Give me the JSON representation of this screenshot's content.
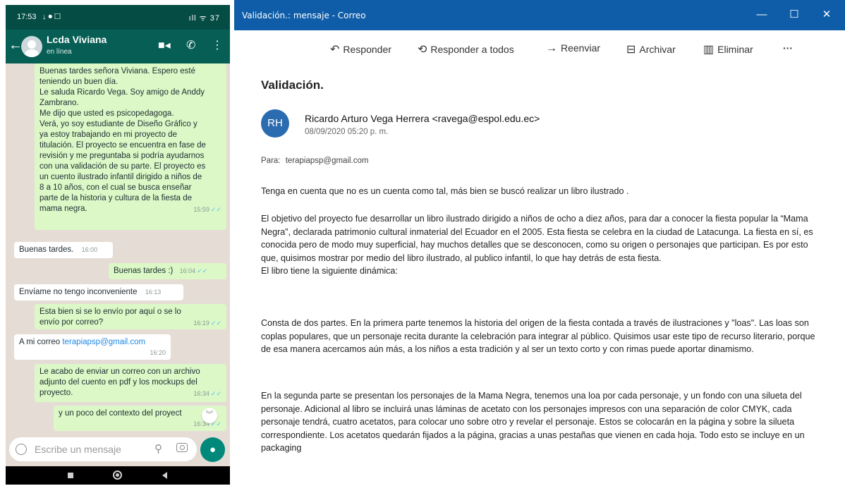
{
  "phone": {
    "status_time": "17:53",
    "status_left_icons": "↓ ⏺ ☐",
    "status_right_icons": "ıll ᯤ 37",
    "contact_name": "Lcda Viviana",
    "contact_presence": "en línea",
    "composer_placeholder": "Escribe un mensaje",
    "messages": [
      {
        "direction": "outgoing",
        "text": "Buenas tardes señora Viviana. Espero esté teniendo un buen día.\nLe saluda Ricardo Vega. Soy amigo de Anddy Zambrano.\nMe dijo que usted es psicopedagoga.\nVerá, yo soy estudiante de Diseño Gráfico y ya estoy trabajando en mi proyecto de titulación. El proyecto se encuentra en fase de revisión y me preguntaba si podría ayudarnos con una validación de su parte. El proyecto es un cuento ilustrado infantil dirigido a niños de 8 a 10 años, con el cual se busca enseñar parte de la historia y cultura de la fiesta de mama negra.",
        "time": "15:59"
      },
      {
        "direction": "incoming",
        "text": "Buenas tardes.",
        "time": "16:00"
      },
      {
        "direction": "outgoing",
        "text": "Buenas tardes :)",
        "time": "16:04"
      },
      {
        "direction": "incoming",
        "text": "Envíame no tengo inconveniente",
        "time": "16:13"
      },
      {
        "direction": "outgoing",
        "text": "Esta bien si se lo envío por aquí o se lo envío por correo?",
        "time": "16:19"
      },
      {
        "direction": "incoming",
        "text": "A mi correo ",
        "link": "terapiapsp@gmail.com",
        "time": "16:20"
      },
      {
        "direction": "outgoing",
        "text": "Le acabo de enviar un correo con un archivo adjunto del cuento en pdf y los mockups del proyecto.",
        "time": "16:34"
      },
      {
        "direction": "outgoing",
        "text": "y un poco del contexto del proyect",
        "time": "16:34"
      }
    ]
  },
  "mail": {
    "window_title": "Validación.: mensaje - Correo",
    "toolbar": {
      "reply": "Responder",
      "reply_all": "Responder a todos",
      "forward": "Reenviar",
      "archive": "Archivar",
      "delete": "Eliminar",
      "more": "···"
    },
    "subject": "Validación.",
    "sender_initials": "RH",
    "sender": "Ricardo Arturo Vega Herrera <ravega@espol.edu.ec>",
    "date": "08/09/2020 05:20 p. m.",
    "to_label": "Para:",
    "to_address": "terapiapsp@gmail.com",
    "body": [
      "Tenga en cuenta que no es un cuenta como tal, más bien se buscó realizar un libro ilustrado .",
      "El objetivo del proyecto fue desarrollar un libro ilustrado dirigido a niños de ocho a diez años, para dar a conocer la fiesta popular la “Mama Negra”, declarada patrimonio cultural inmaterial del Ecuador en el 2005.  Esta fiesta se celebra en la ciudad de Latacunga. La fiesta en sí, es conocida pero de modo muy superficial, hay muchos detalles que se desconocen, como su origen o personajes que participan. Es por esto que, quisimos mostrar por medio del libro ilustrado, al publico infantil, lo que hay detrás de esta fiesta.\nEl libro tiene la siguiente dinámica:",
      "Consta de dos partes. En la primera parte tenemos la historia del origen de la fiesta contada a través de ilustraciones y \"loas\". Las loas son coplas populares, que un personaje recita durante la celebración para integrar al público. Quisimos usar este tipo de recurso literario, porque de esa manera acercamos aún más, a los niños a esta tradición y al ser un texto corto y con rimas puede aportar dinamismo.",
      "En la segunda parte se presentan los personajes de la Mama Negra, tenemos una loa por cada personaje, y un fondo con una silueta del personaje. Adicional al libro se incluirá unas láminas de acetato con los personajes impresos con una separación de color CMYK, cada personaje tendrá, cuatro acetatos, para colocar uno sobre otro y revelar el personaje. Estos se colocarán en la página y sobre la silueta correspondiente. Los acetatos quedarán fijados a la página, gracias a unas pestañas que vienen en cada hoja. Todo esto se incluye en un packaging"
    ]
  },
  "colors": {
    "whatsapp_header": "#075e54",
    "outgoing_bubble": "#dcf8c6",
    "chat_background": "#e5ddd5",
    "mail_titlebar": "#0f5da8",
    "avatar": "#2b6cb0"
  }
}
